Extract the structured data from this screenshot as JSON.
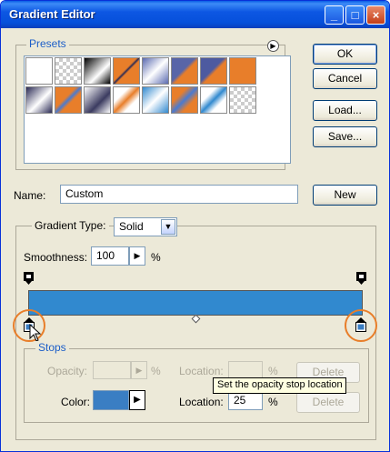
{
  "window": {
    "title": "Gradient Editor",
    "minimize": "_",
    "maximize": "□",
    "close": "×"
  },
  "presets": {
    "legend": "Presets"
  },
  "buttons": {
    "ok": "OK",
    "cancel": "Cancel",
    "load": "Load...",
    "save": "Save...",
    "new": "New"
  },
  "name_field": {
    "label": "Name:",
    "value": "Custom"
  },
  "gradient": {
    "type_label": "Gradient Type:",
    "type_value": "Solid",
    "smoothness_label": "Smoothness:",
    "smoothness_value": "100",
    "smoothness_unit": "%",
    "bar_color": "#3189cf"
  },
  "stops": {
    "legend": "Stops",
    "opacity_label": "Opacity:",
    "opacity_unit": "%",
    "opacity_location_label": "Location:",
    "opacity_location_unit": "%",
    "delete_label": "Delete",
    "color_label": "Color:",
    "color_value": "#3a7ec3",
    "color_location_label": "Location:",
    "color_location_value": "25",
    "color_location_unit": "%"
  },
  "tooltip": "Set the opacity stop location",
  "colors": {
    "accent": "#e87e2a",
    "title_blue": "#0a5fe6",
    "legend_blue": "#1c5ec8"
  }
}
